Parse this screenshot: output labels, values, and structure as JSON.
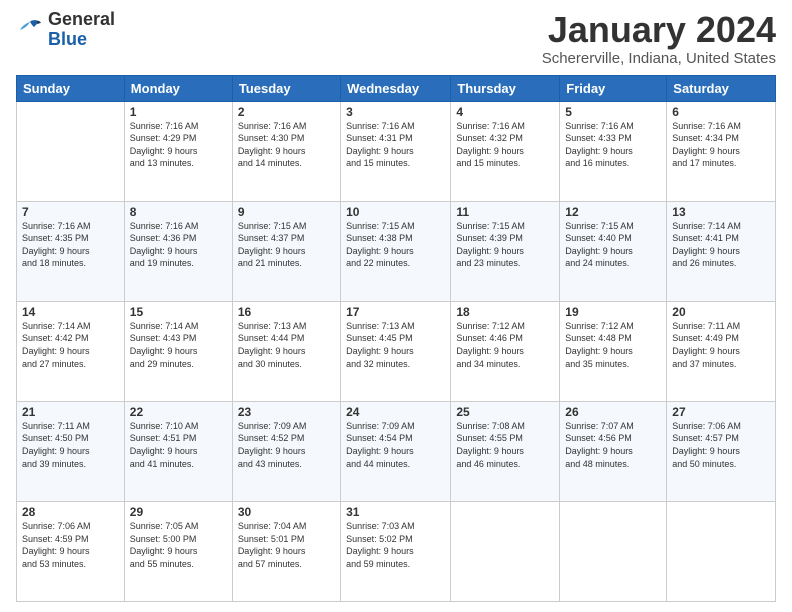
{
  "logo": {
    "general": "General",
    "blue": "Blue"
  },
  "header": {
    "month": "January 2024",
    "location": "Schererville, Indiana, United States"
  },
  "weekdays": [
    "Sunday",
    "Monday",
    "Tuesday",
    "Wednesday",
    "Thursday",
    "Friday",
    "Saturday"
  ],
  "weeks": [
    [
      {
        "day": "",
        "info": ""
      },
      {
        "day": "1",
        "info": "Sunrise: 7:16 AM\nSunset: 4:29 PM\nDaylight: 9 hours\nand 13 minutes."
      },
      {
        "day": "2",
        "info": "Sunrise: 7:16 AM\nSunset: 4:30 PM\nDaylight: 9 hours\nand 14 minutes."
      },
      {
        "day": "3",
        "info": "Sunrise: 7:16 AM\nSunset: 4:31 PM\nDaylight: 9 hours\nand 15 minutes."
      },
      {
        "day": "4",
        "info": "Sunrise: 7:16 AM\nSunset: 4:32 PM\nDaylight: 9 hours\nand 15 minutes."
      },
      {
        "day": "5",
        "info": "Sunrise: 7:16 AM\nSunset: 4:33 PM\nDaylight: 9 hours\nand 16 minutes."
      },
      {
        "day": "6",
        "info": "Sunrise: 7:16 AM\nSunset: 4:34 PM\nDaylight: 9 hours\nand 17 minutes."
      }
    ],
    [
      {
        "day": "7",
        "info": "Sunrise: 7:16 AM\nSunset: 4:35 PM\nDaylight: 9 hours\nand 18 minutes."
      },
      {
        "day": "8",
        "info": "Sunrise: 7:16 AM\nSunset: 4:36 PM\nDaylight: 9 hours\nand 19 minutes."
      },
      {
        "day": "9",
        "info": "Sunrise: 7:15 AM\nSunset: 4:37 PM\nDaylight: 9 hours\nand 21 minutes."
      },
      {
        "day": "10",
        "info": "Sunrise: 7:15 AM\nSunset: 4:38 PM\nDaylight: 9 hours\nand 22 minutes."
      },
      {
        "day": "11",
        "info": "Sunrise: 7:15 AM\nSunset: 4:39 PM\nDaylight: 9 hours\nand 23 minutes."
      },
      {
        "day": "12",
        "info": "Sunrise: 7:15 AM\nSunset: 4:40 PM\nDaylight: 9 hours\nand 24 minutes."
      },
      {
        "day": "13",
        "info": "Sunrise: 7:14 AM\nSunset: 4:41 PM\nDaylight: 9 hours\nand 26 minutes."
      }
    ],
    [
      {
        "day": "14",
        "info": "Sunrise: 7:14 AM\nSunset: 4:42 PM\nDaylight: 9 hours\nand 27 minutes."
      },
      {
        "day": "15",
        "info": "Sunrise: 7:14 AM\nSunset: 4:43 PM\nDaylight: 9 hours\nand 29 minutes."
      },
      {
        "day": "16",
        "info": "Sunrise: 7:13 AM\nSunset: 4:44 PM\nDaylight: 9 hours\nand 30 minutes."
      },
      {
        "day": "17",
        "info": "Sunrise: 7:13 AM\nSunset: 4:45 PM\nDaylight: 9 hours\nand 32 minutes."
      },
      {
        "day": "18",
        "info": "Sunrise: 7:12 AM\nSunset: 4:46 PM\nDaylight: 9 hours\nand 34 minutes."
      },
      {
        "day": "19",
        "info": "Sunrise: 7:12 AM\nSunset: 4:48 PM\nDaylight: 9 hours\nand 35 minutes."
      },
      {
        "day": "20",
        "info": "Sunrise: 7:11 AM\nSunset: 4:49 PM\nDaylight: 9 hours\nand 37 minutes."
      }
    ],
    [
      {
        "day": "21",
        "info": "Sunrise: 7:11 AM\nSunset: 4:50 PM\nDaylight: 9 hours\nand 39 minutes."
      },
      {
        "day": "22",
        "info": "Sunrise: 7:10 AM\nSunset: 4:51 PM\nDaylight: 9 hours\nand 41 minutes."
      },
      {
        "day": "23",
        "info": "Sunrise: 7:09 AM\nSunset: 4:52 PM\nDaylight: 9 hours\nand 43 minutes."
      },
      {
        "day": "24",
        "info": "Sunrise: 7:09 AM\nSunset: 4:54 PM\nDaylight: 9 hours\nand 44 minutes."
      },
      {
        "day": "25",
        "info": "Sunrise: 7:08 AM\nSunset: 4:55 PM\nDaylight: 9 hours\nand 46 minutes."
      },
      {
        "day": "26",
        "info": "Sunrise: 7:07 AM\nSunset: 4:56 PM\nDaylight: 9 hours\nand 48 minutes."
      },
      {
        "day": "27",
        "info": "Sunrise: 7:06 AM\nSunset: 4:57 PM\nDaylight: 9 hours\nand 50 minutes."
      }
    ],
    [
      {
        "day": "28",
        "info": "Sunrise: 7:06 AM\nSunset: 4:59 PM\nDaylight: 9 hours\nand 53 minutes."
      },
      {
        "day": "29",
        "info": "Sunrise: 7:05 AM\nSunset: 5:00 PM\nDaylight: 9 hours\nand 55 minutes."
      },
      {
        "day": "30",
        "info": "Sunrise: 7:04 AM\nSunset: 5:01 PM\nDaylight: 9 hours\nand 57 minutes."
      },
      {
        "day": "31",
        "info": "Sunrise: 7:03 AM\nSunset: 5:02 PM\nDaylight: 9 hours\nand 59 minutes."
      },
      {
        "day": "",
        "info": ""
      },
      {
        "day": "",
        "info": ""
      },
      {
        "day": "",
        "info": ""
      }
    ]
  ]
}
